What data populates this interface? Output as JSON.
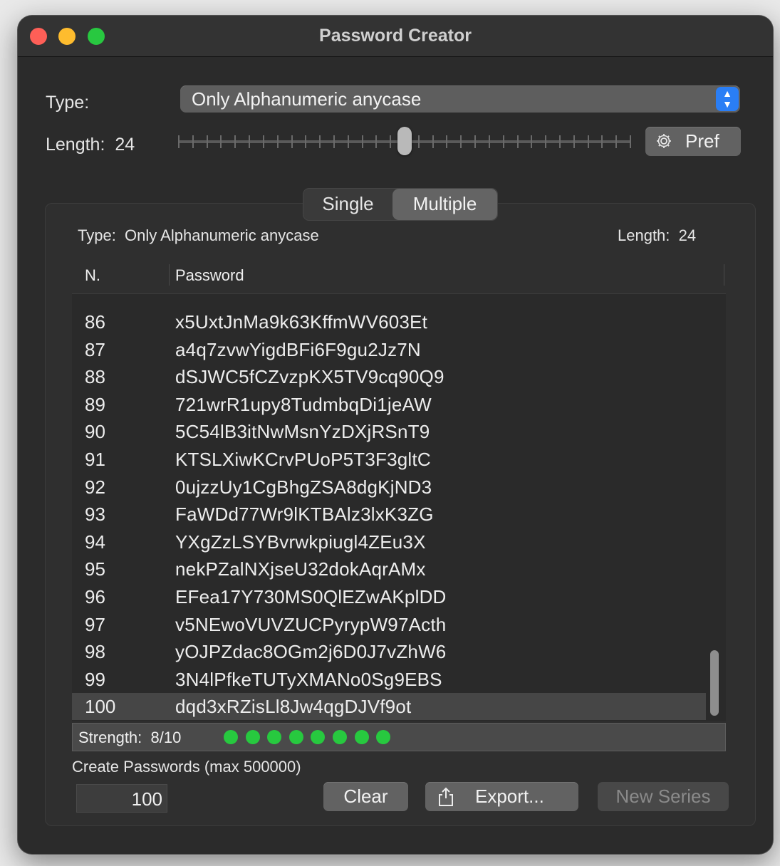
{
  "window": {
    "title": "Password Creator"
  },
  "settings": {
    "type_label": "Type:",
    "type_value": "Only Alphanumeric anycase",
    "length_label": "Length:",
    "length_value": "24",
    "pref_label": "Pref"
  },
  "slider": {
    "min": 8,
    "max": 40,
    "value": 24
  },
  "tabs": {
    "single": "Single",
    "multiple": "Multiple",
    "selected": "Multiple"
  },
  "info": {
    "type_label": "Type:",
    "type_value": "Only Alphanumeric anycase",
    "length_label": "Length:",
    "length_value": "24"
  },
  "table": {
    "col_number": "N.",
    "col_password": "Password",
    "rows": [
      {
        "n": "86",
        "p": "x5UxtJnMa9k63KffmWV603Et"
      },
      {
        "n": "87",
        "p": "a4q7zvwYigdBFi6F9gu2Jz7N"
      },
      {
        "n": "88",
        "p": "dSJWC5fCZvzpKX5TV9cq90Q9"
      },
      {
        "n": "89",
        "p": "721wrR1upy8TudmbqDi1jeAW"
      },
      {
        "n": "90",
        "p": "5C54lB3itNwMsnYzDXjRSnT9"
      },
      {
        "n": "91",
        "p": "KTSLXiwKCrvPUoP5T3F3gltC"
      },
      {
        "n": "92",
        "p": "0ujzzUy1CgBhgZSA8dgKjND3"
      },
      {
        "n": "93",
        "p": "FaWDd77Wr9lKTBAlz3lxK3ZG"
      },
      {
        "n": "94",
        "p": "YXgZzLSYBvrwkpiugl4ZEu3X"
      },
      {
        "n": "95",
        "p": "nekPZalNXjseU32dokAqrAMx"
      },
      {
        "n": "96",
        "p": "EFea17Y730MS0QlEZwAKplDD"
      },
      {
        "n": "97",
        "p": "v5NEwoVUVZUCPyrypW97Acth"
      },
      {
        "n": "98",
        "p": "yOJPZdac8OGm2j6D0J7vZhW6"
      },
      {
        "n": "99",
        "p": "3N4lPfkeTUTyXMANo0Sg9EBS"
      },
      {
        "n": "100",
        "p": "dqd3xRZisLl8Jw4qgDJVf9ot"
      }
    ],
    "selected_row": "100"
  },
  "strength": {
    "label": "Strength:",
    "value_text": "8/10",
    "dots": 8
  },
  "create": {
    "label": "Create Passwords (max 500000)",
    "count": "100",
    "clear_label": "Clear",
    "export_label": "Export...",
    "new_series_label": "New Series"
  },
  "icons": {
    "gear": "gear-icon",
    "share": "share-icon",
    "updown": "updown-chevron-icon"
  },
  "colors": {
    "accent": "#2a7ef5",
    "strength_dot": "#27c93f",
    "window_bg": "#2b2b2b"
  }
}
